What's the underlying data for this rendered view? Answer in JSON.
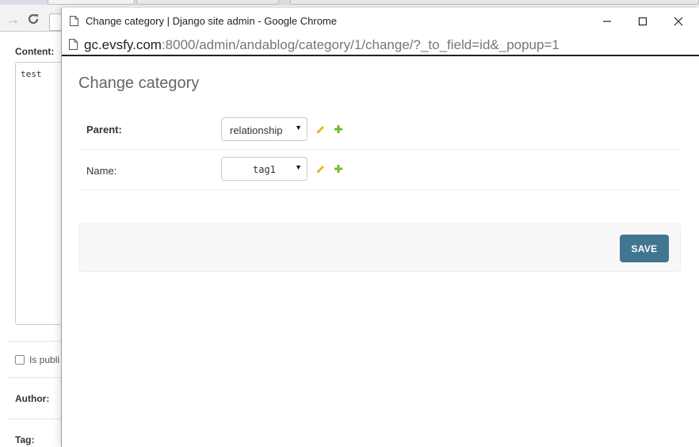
{
  "background_page": {
    "content_label": "Content:",
    "content_value": "test",
    "is_published_label": "Is publi",
    "author_label": "Author:",
    "tag_label": "Tag:"
  },
  "popup": {
    "window_title": "Change category | Django site admin - Google Chrome",
    "url_host": "gc.evsfy.com",
    "url_path": ":8000/admin/andablog/category/1/change/?_to_field=id&_popup=1"
  },
  "form": {
    "page_title": "Change category",
    "fields": [
      {
        "label": "Parent:",
        "value": "relationship",
        "required": true
      },
      {
        "label": "Name:",
        "value": "tag1",
        "required": false
      }
    ],
    "save_label": "SAVE"
  },
  "colors": {
    "save_button": "#417690",
    "edit_icon": "#efb80b",
    "add_icon": "#70bf2b"
  },
  "icons": {
    "edit": "pencil-icon",
    "add": "plus-icon"
  }
}
